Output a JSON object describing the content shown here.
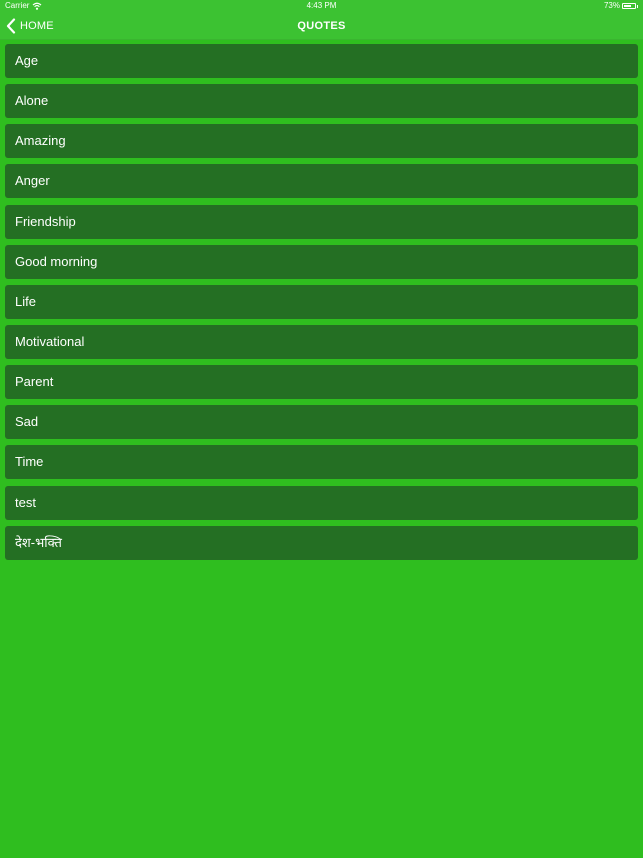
{
  "status_bar": {
    "carrier": "Carrier",
    "time": "4:43 PM",
    "battery": "73%",
    "battery_level": 0.73
  },
  "nav": {
    "back_label": "HOME",
    "title": "QUOTES"
  },
  "categories": [
    {
      "label": "Age"
    },
    {
      "label": "Alone"
    },
    {
      "label": "Amazing"
    },
    {
      "label": "Anger"
    },
    {
      "label": "Friendship"
    },
    {
      "label": "Good morning"
    },
    {
      "label": "Life"
    },
    {
      "label": "Motivational"
    },
    {
      "label": "Parent"
    },
    {
      "label": "Sad"
    },
    {
      "label": "Time"
    },
    {
      "label": "test"
    },
    {
      "label": "देश-भक्ति"
    }
  ],
  "colors": {
    "background": "#2fbe1f",
    "header": "#3cc232",
    "item": "#246f23",
    "text": "#ffffff"
  }
}
